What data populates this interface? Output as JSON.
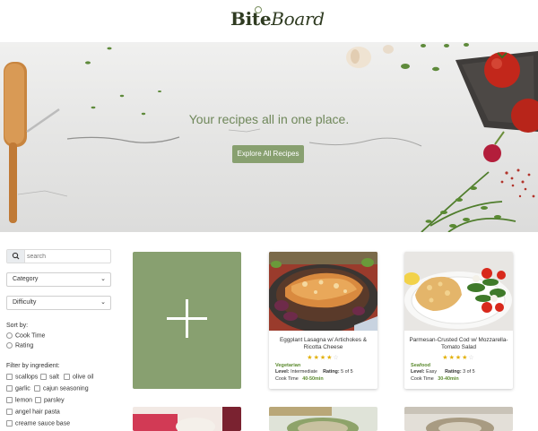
{
  "header": {
    "logo_bite": "Bite",
    "logo_board": "Board"
  },
  "hero": {
    "title": "Your recipes all in one place.",
    "button_label": "Explore All Recipes"
  },
  "sidebar": {
    "search_placeholder": "search",
    "category_select": "Category",
    "difficulty_select": "Difficulty",
    "sort_label": "Sort by:",
    "sort_options": [
      "Cook Time",
      "Rating"
    ],
    "filter_label": "Filter by ingredient:",
    "ingredients": [
      "scallops",
      "salt",
      "olive oil",
      "garlic",
      "cajun seasoning",
      "lemon",
      "parsley",
      "angel hair pasta",
      "creame sauce base"
    ]
  },
  "recipes": [
    {
      "title": "Eggplant Lasagna w/ Artichokes & Ricotta Cheese",
      "rating": 4,
      "max_rating": 5,
      "category": "Vegetarian",
      "level_label": "Level:",
      "level": "Intermediate",
      "rating_label": "Rating:",
      "rating_text": "5 of 5",
      "cook_label": "Cook Time",
      "cook_time": "40-50min"
    },
    {
      "title": "Parmesan-Crusted Cod w/ Mozzarella-Tomato Salad",
      "rating": 4,
      "max_rating": 5,
      "category": "Seafood",
      "level_label": "Level:",
      "level": "Easy",
      "rating_label": "Rating:",
      "rating_text": "3 of 5",
      "cook_label": "Cook Time",
      "cook_time": "30-40min"
    }
  ],
  "colors": {
    "accent": "#88a070",
    "hero_text": "#6f875a",
    "category_text": "#5b8a2e",
    "star": "#e2b007"
  },
  "icons": {
    "search": "search-icon",
    "add": "plus-icon",
    "chevron": "chevron-down-icon"
  }
}
